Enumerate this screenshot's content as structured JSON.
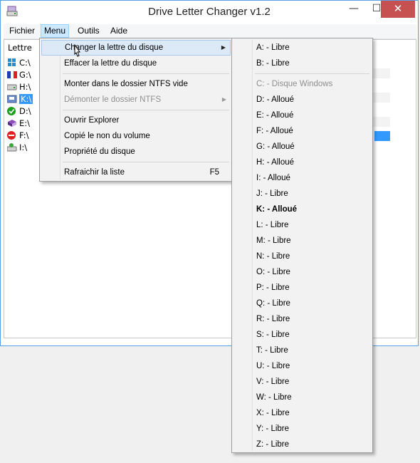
{
  "window": {
    "title": "Drive Letter Changer v1.2",
    "controls": {
      "minimize": "—",
      "maximize": "☐",
      "close": "✕"
    }
  },
  "menubar": {
    "items": [
      "Fichier",
      "Menu",
      "Outils",
      "Aide"
    ],
    "active": "Menu"
  },
  "list": {
    "column_header": "Lettre",
    "drives": [
      {
        "letter": "C:\\",
        "icon": "windows-drive-icon",
        "selected": false
      },
      {
        "letter": "G:\\",
        "icon": "french-flag-icon",
        "selected": false
      },
      {
        "letter": "H:\\",
        "icon": "hard-drive-icon",
        "selected": false
      },
      {
        "letter": "K:\\",
        "icon": "usb-drive-icon",
        "selected": true
      },
      {
        "letter": "D:\\",
        "icon": "green-check-icon",
        "selected": false
      },
      {
        "letter": "E:\\",
        "icon": "book-icon",
        "selected": false
      },
      {
        "letter": "F:\\",
        "icon": "red-no-entry-icon",
        "selected": false
      },
      {
        "letter": "I:\\",
        "icon": "recycle-drive-icon",
        "selected": false
      }
    ]
  },
  "context_menu": {
    "items": [
      {
        "label": "Changer la lettre du disque",
        "submenu": true,
        "highlighted": true,
        "disabled": false
      },
      {
        "label": "Effacer la lettre du disque",
        "submenu": false,
        "highlighted": false,
        "disabled": false
      },
      {
        "label": "Monter dans le dossier NTFS vide",
        "submenu": false,
        "highlighted": false,
        "disabled": false
      },
      {
        "label": "Démonter le dossier NTFS",
        "submenu": true,
        "highlighted": false,
        "disabled": true
      },
      {
        "label": "Ouvrir Explorer",
        "submenu": false,
        "highlighted": false,
        "disabled": false
      },
      {
        "label": "Copié le non du volume",
        "submenu": false,
        "highlighted": false,
        "disabled": false
      },
      {
        "label": "Propriété du disque",
        "submenu": false,
        "highlighted": false,
        "disabled": false
      },
      {
        "label": "Rafraichir la liste",
        "shortcut": "F5",
        "submenu": false,
        "highlighted": false,
        "disabled": false
      }
    ]
  },
  "submenu": {
    "items": [
      {
        "label": "A: - Libre",
        "disabled": false,
        "bold": false
      },
      {
        "label": "B: - Libre",
        "disabled": false,
        "bold": false
      },
      {
        "label": "C: - Disque Windows",
        "disabled": true,
        "bold": false
      },
      {
        "label": "D: - Alloué",
        "disabled": false,
        "bold": false
      },
      {
        "label": "E: - Alloué",
        "disabled": false,
        "bold": false
      },
      {
        "label": "F: - Alloué",
        "disabled": false,
        "bold": false
      },
      {
        "label": "G: - Alloué",
        "disabled": false,
        "bold": false
      },
      {
        "label": "H: - Alloué",
        "disabled": false,
        "bold": false
      },
      {
        "label": "I: - Alloué",
        "disabled": false,
        "bold": false
      },
      {
        "label": "J: - Libre",
        "disabled": false,
        "bold": false
      },
      {
        "label": "K: - Alloué",
        "disabled": false,
        "bold": true
      },
      {
        "label": "L: - Libre",
        "disabled": false,
        "bold": false
      },
      {
        "label": "M: - Libre",
        "disabled": false,
        "bold": false
      },
      {
        "label": "N: - Libre",
        "disabled": false,
        "bold": false
      },
      {
        "label": "O: - Libre",
        "disabled": false,
        "bold": false
      },
      {
        "label": "P: - Libre",
        "disabled": false,
        "bold": false
      },
      {
        "label": "Q: - Libre",
        "disabled": false,
        "bold": false
      },
      {
        "label": "R: - Libre",
        "disabled": false,
        "bold": false
      },
      {
        "label": "S: - Libre",
        "disabled": false,
        "bold": false
      },
      {
        "label": "T: - Libre",
        "disabled": false,
        "bold": false
      },
      {
        "label": "U: - Libre",
        "disabled": false,
        "bold": false
      },
      {
        "label": "V: - Libre",
        "disabled": false,
        "bold": false
      },
      {
        "label": "W: - Libre",
        "disabled": false,
        "bold": false
      },
      {
        "label": "X: - Libre",
        "disabled": false,
        "bold": false
      },
      {
        "label": "Y: - Libre",
        "disabled": false,
        "bold": false
      },
      {
        "label": "Z: - Libre",
        "disabled": false,
        "bold": false
      }
    ]
  },
  "colors": {
    "selection": "#3399ff",
    "menu_highlight": "#dce9f7",
    "close_button": "#c75050",
    "disabled_text": "#8f8f8f"
  }
}
